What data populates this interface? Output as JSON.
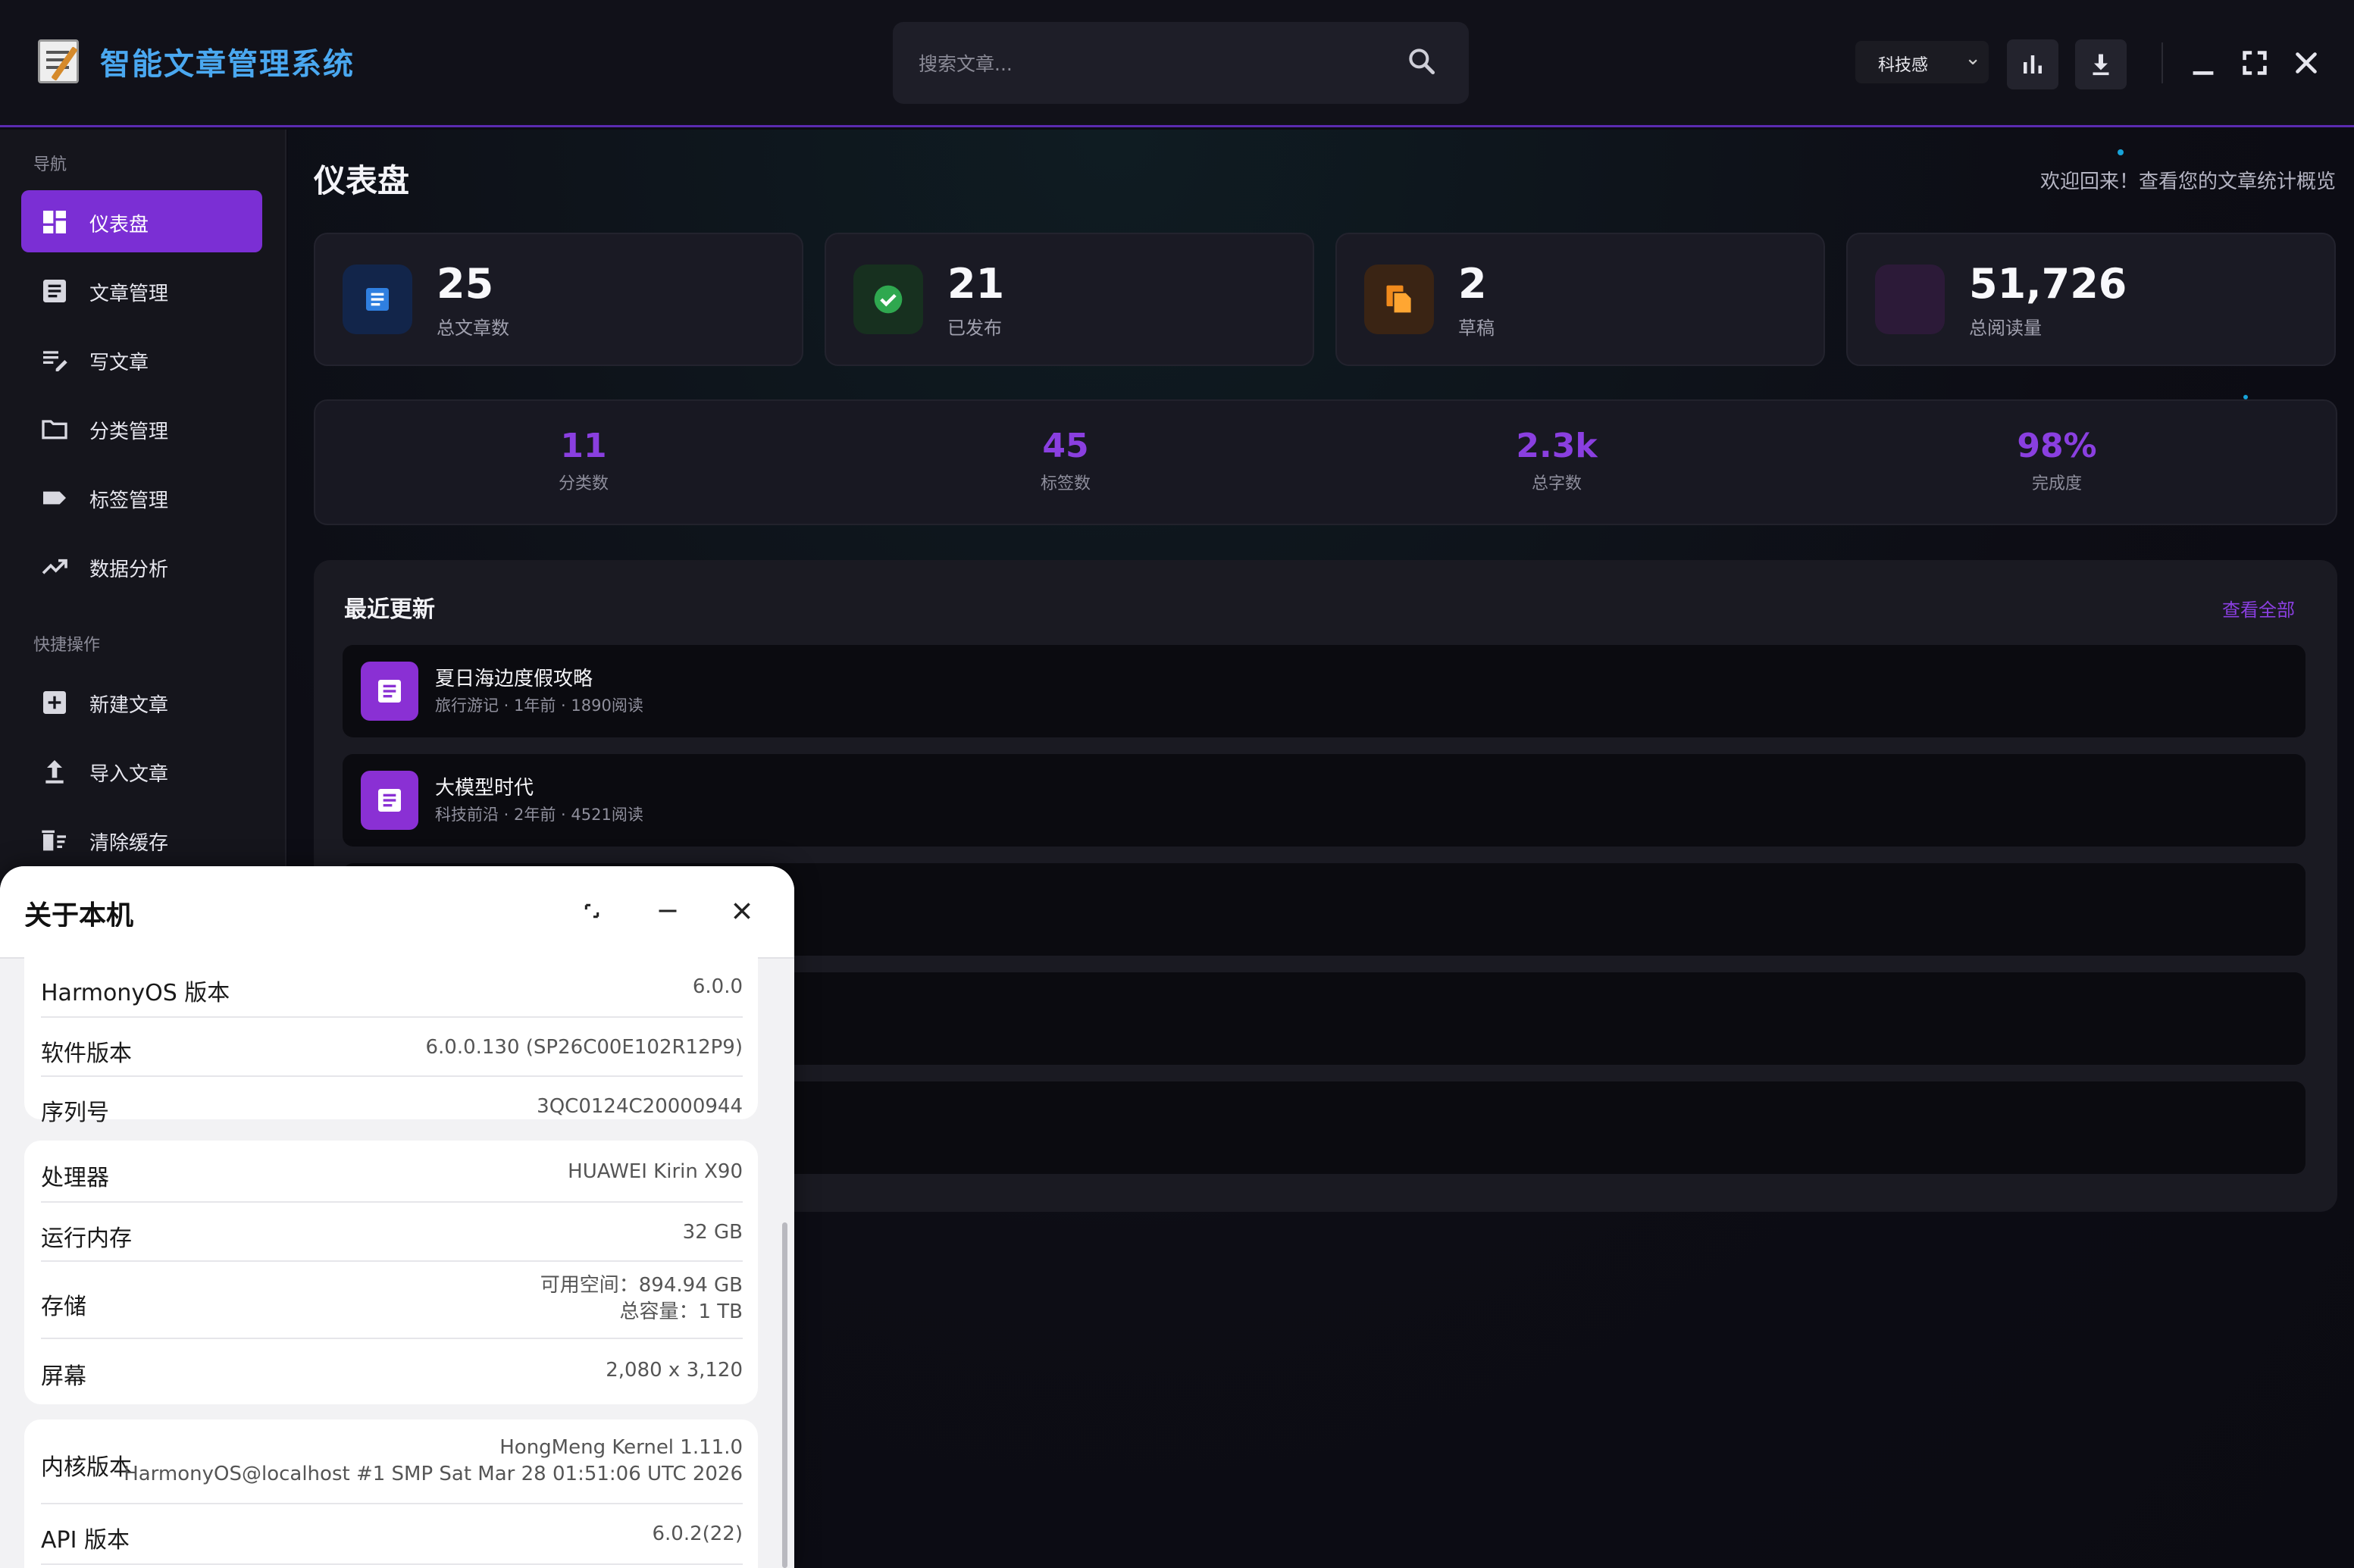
{
  "app": {
    "title": "智能文章管理系统"
  },
  "header": {
    "search_placeholder": "搜索文章...",
    "theme_select": "科技感"
  },
  "sidebar": {
    "nav_title": "导航",
    "nav_items": [
      {
        "label": "仪表盘",
        "icon": "dashboard-icon"
      },
      {
        "label": "文章管理",
        "icon": "article-icon"
      },
      {
        "label": "写文章",
        "icon": "edit-note-icon"
      },
      {
        "label": "分类管理",
        "icon": "folder-icon"
      },
      {
        "label": "标签管理",
        "icon": "tag-icon"
      },
      {
        "label": "数据分析",
        "icon": "trending-up-icon"
      }
    ],
    "quick_title": "快捷操作",
    "quick_items": [
      {
        "label": "新建文章",
        "icon": "add-box-icon"
      },
      {
        "label": "导入文章",
        "icon": "upload-icon"
      },
      {
        "label": "清除缓存",
        "icon": "delete-sweep-icon"
      }
    ]
  },
  "main": {
    "page_title": "仪表盘",
    "welcome": "欢迎回来！查看您的文章统计概览",
    "stats": [
      {
        "value": "25",
        "label": "总文章数",
        "icon": "article-icon",
        "color": "#2f7fe0"
      },
      {
        "value": "21",
        "label": "已发布",
        "icon": "check-circle-icon",
        "color": "#2fa84f"
      },
      {
        "value": "2",
        "label": "草稿",
        "icon": "file-copy-icon",
        "color": "#f08a1c"
      },
      {
        "value": "51,726",
        "label": "总阅读量",
        "icon": "eye-icon",
        "color": "#9b3fd6"
      }
    ],
    "mini_stats": [
      {
        "value": "11",
        "label": "分类数"
      },
      {
        "value": "45",
        "label": "标签数"
      },
      {
        "value": "2.3k",
        "label": "总字数"
      },
      {
        "value": "98%",
        "label": "完成度"
      }
    ],
    "recent": {
      "title": "最近更新",
      "view_all": "查看全部",
      "items": [
        {
          "title": "夏日海边度假攻略",
          "meta": "旅行游记 · 1年前 · 1890阅读"
        },
        {
          "title": "大模型时代",
          "meta": "科技前沿 · 2年前 · 4521阅读"
        }
      ]
    }
  },
  "dialog": {
    "title": "关于本机",
    "groups": [
      [
        {
          "key": "HarmonyOS 版本",
          "value": "6.0.0"
        },
        {
          "key": "软件版本",
          "value": "6.0.0.130 (SP26C00E102R12P9)"
        },
        {
          "key": "序列号",
          "value": "3QC0124C20000944"
        }
      ],
      [
        {
          "key": "处理器",
          "value": "HUAWEI Kirin X90"
        },
        {
          "key": "运行内存",
          "value": "32 GB"
        },
        {
          "key": "存储",
          "value": "可用空间：894.94 GB",
          "value2": "总容量：1 TB"
        },
        {
          "key": "屏幕",
          "value": "2,080 x 3,120"
        }
      ],
      [
        {
          "key": "内核版本",
          "value": "HongMeng Kernel 1.11.0",
          "value2": "HarmonyOS@localhost #1 SMP Sat Mar 28 01:51:06 UTC 2026"
        },
        {
          "key": "API 版本",
          "value": "6.0.2(22)"
        }
      ]
    ]
  }
}
